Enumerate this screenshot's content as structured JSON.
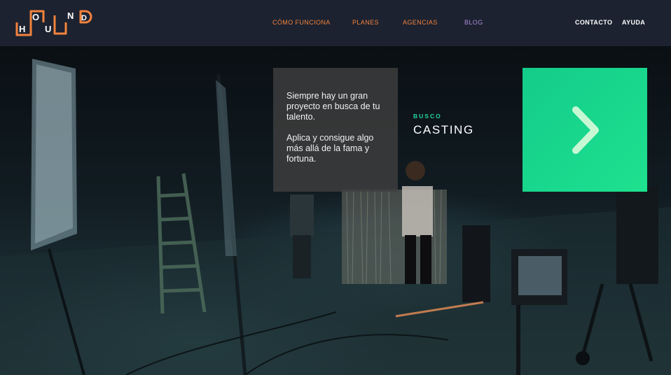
{
  "brand": {
    "letters": [
      "H",
      "O",
      "U",
      "N",
      "D"
    ],
    "logo_color": "#f2833c"
  },
  "nav": {
    "left": [
      {
        "label": "CÓMO FUNCIONA",
        "color": "#f2833c"
      },
      {
        "label": "PLANES",
        "color": "#f2833c"
      },
      {
        "label": "AGENCIAS",
        "color": "#f2833c"
      },
      {
        "label": "BLOG",
        "color": "#a98bd8"
      }
    ],
    "right": [
      {
        "label": "CONTACTO"
      },
      {
        "label": "AYUDA"
      }
    ]
  },
  "hero": {
    "message": {
      "line1": "Siempre hay un gran proyecto en busca de tu talento.",
      "line2": "Aplica y consigue algo más allá de la fama y fortuna."
    },
    "busco": "BUSCO",
    "casting": "CASTING",
    "cta_icon": "chevron-right-icon",
    "accent": "#1ee18f"
  }
}
